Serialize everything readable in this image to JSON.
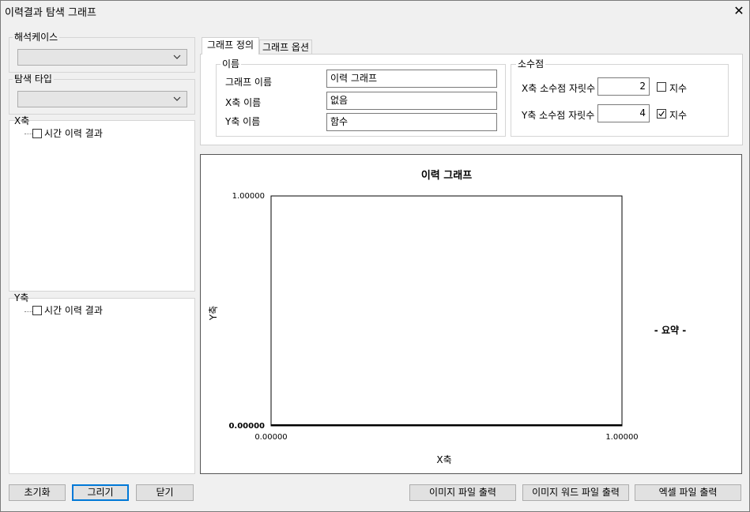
{
  "window": {
    "title": "이력결과 탐색 그래프"
  },
  "left_panel": {
    "analysis_case": {
      "label": "해석케이스",
      "value": ""
    },
    "search_type": {
      "label": "탐색 타입",
      "value": ""
    },
    "x_axis": {
      "label": "X축",
      "item": "시간 이력 결과"
    },
    "y_axis": {
      "label": "Y축",
      "item": "시간 이력 결과"
    }
  },
  "tabs": [
    {
      "label": "그래프 정의"
    },
    {
      "label": "그래프 옵션"
    }
  ],
  "names": {
    "group_label": "이름",
    "graph_name_label": "그래프 이름",
    "graph_name_value": "이력 그래프",
    "x_name_label": "X축 이름",
    "x_name_value": "없음",
    "y_name_label": "Y축 이름",
    "y_name_value": "함수"
  },
  "decimals": {
    "group_label": "소수점",
    "x_label": "X축 소수점 자릿수",
    "x_value": "2",
    "x_exponent_label": "지수",
    "x_exponent_checked": false,
    "y_label": "Y축 소수점 자릿수",
    "y_value": "4",
    "y_exponent_label": "지수",
    "y_exponent_checked": true
  },
  "chart_data": {
    "type": "line",
    "title": "이력 그래프",
    "xlabel": "X축",
    "ylabel": "Y축",
    "xlim": [
      0,
      1
    ],
    "ylim": [
      0,
      1
    ],
    "x_ticks": [
      "0.00000",
      "1.00000"
    ],
    "y_ticks": [
      "0.00000",
      "1.00000"
    ],
    "series": [],
    "summary_label": "- 요약 -",
    "grid": false
  },
  "buttons": {
    "reset": "초기화",
    "draw": "그리기",
    "close": "닫기",
    "export_image": "이미지 파일 출력",
    "export_image_word": "이미지 워드 파일 출력",
    "export_excel": "엑셀 파일 출력"
  }
}
